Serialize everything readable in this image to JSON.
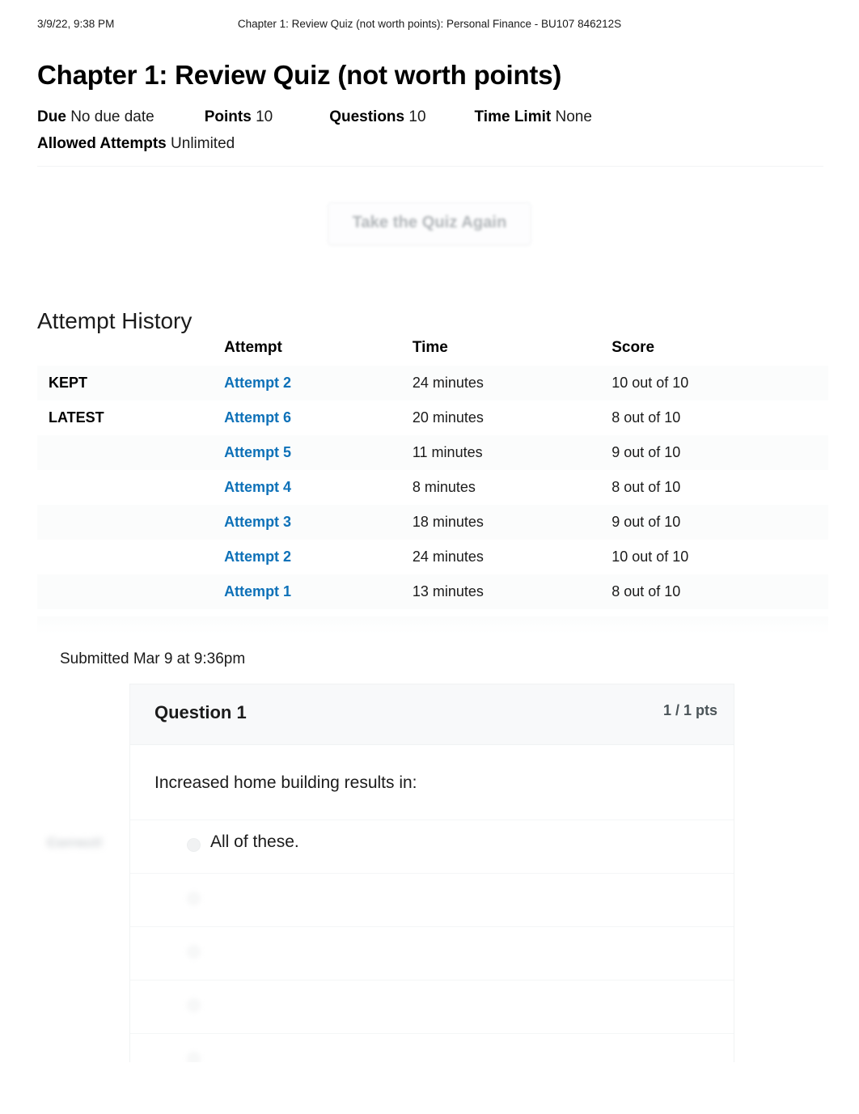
{
  "print_header": {
    "date": "3/9/22, 9:38 PM",
    "title": "Chapter 1: Review Quiz (not worth points): Personal Finance - BU107 846212S"
  },
  "page_title": "Chapter 1: Review Quiz (not worth points)",
  "quiz_meta": {
    "due_label": "Due",
    "due_value": "No due date",
    "points_label": "Points",
    "points_value": "10",
    "questions_label": "Questions",
    "questions_value": "10",
    "time_limit_label": "Time Limit",
    "time_limit_value": "None",
    "allowed_attempts_label": "Allowed Attempts",
    "allowed_attempts_value": "Unlimited"
  },
  "actions": {
    "retake_label": "Take the Quiz Again"
  },
  "attempt_history": {
    "heading": "Attempt History",
    "columns": [
      "",
      "Attempt",
      "Time",
      "Score"
    ],
    "rows": [
      {
        "flag": "KEPT",
        "attempt": "Attempt 2",
        "time": "24 minutes",
        "score": "10 out of 10"
      },
      {
        "flag": "LATEST",
        "attempt": "Attempt 6",
        "time": "20 minutes",
        "score": "8 out of 10"
      },
      {
        "flag": "",
        "attempt": "Attempt 5",
        "time": "11 minutes",
        "score": "9 out of 10"
      },
      {
        "flag": "",
        "attempt": "Attempt 4",
        "time": "8 minutes",
        "score": "8 out of 10"
      },
      {
        "flag": "",
        "attempt": "Attempt 3",
        "time": "18 minutes",
        "score": "9 out of 10"
      },
      {
        "flag": "",
        "attempt": "Attempt 2",
        "time": "24 minutes",
        "score": "10 out of 10"
      },
      {
        "flag": "",
        "attempt": "Attempt 1",
        "time": "13 minutes",
        "score": "8 out of 10"
      }
    ]
  },
  "submission": {
    "submitted_text": "Submitted Mar 9 at 9:36pm"
  },
  "question": {
    "number_label": "Question 1",
    "points_label": "1 / 1 pts",
    "prompt": "Increased home building results in:",
    "correct_marker": "Correct!",
    "answers": [
      {
        "text": "All of these.",
        "blurred": false,
        "selected": true
      },
      {
        "text": "",
        "blurred": true,
        "selected": false
      },
      {
        "text": "",
        "blurred": true,
        "selected": false
      },
      {
        "text": "",
        "blurred": true,
        "selected": false
      },
      {
        "text": "",
        "blurred": true,
        "selected": false
      }
    ]
  },
  "colors": {
    "link_blue": "#0e71b8",
    "text_dark": "#1b1b1b",
    "header_bg": "#f8f9fa",
    "row_alt_bg": "#fbfcfc",
    "border_light": "#f0f2f3"
  }
}
